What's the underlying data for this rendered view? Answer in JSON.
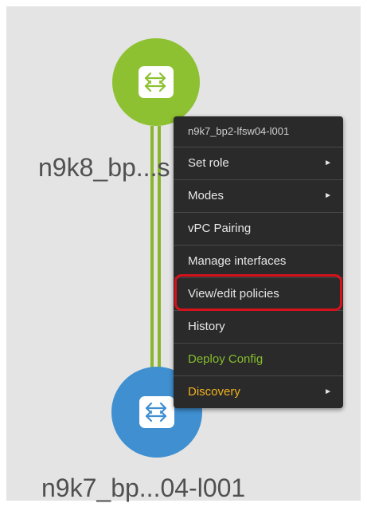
{
  "nodes": {
    "top_label": "n9k8_bp...s",
    "bottom_label": "n9k7_bp...04-l001"
  },
  "context_menu": {
    "header": "n9k7_bp2-lfsw04-l001",
    "items": [
      {
        "label": "Set role",
        "submenu": true
      },
      {
        "label": "Modes",
        "submenu": true
      },
      {
        "label": "vPC Pairing",
        "submenu": false
      },
      {
        "label": "Manage interfaces",
        "submenu": false
      },
      {
        "label": "View/edit policies",
        "submenu": false
      },
      {
        "label": "History",
        "submenu": false
      },
      {
        "label": "Deploy Config",
        "submenu": false
      },
      {
        "label": "Discovery",
        "submenu": true
      }
    ],
    "submenu_glyph": "►"
  },
  "colors": {
    "green_node": "#8dc131",
    "blue_node": "#3f8fd1",
    "link": "#8bb52e",
    "menu_bg": "#2a2a2a",
    "deploy_text": "#84bd2c",
    "discovery_text": "#f0b21e",
    "highlight": "#d6121b"
  },
  "icons": {
    "node_icon": "switch-arrows-icon",
    "submenu_icon": "triangle-right-icon"
  }
}
